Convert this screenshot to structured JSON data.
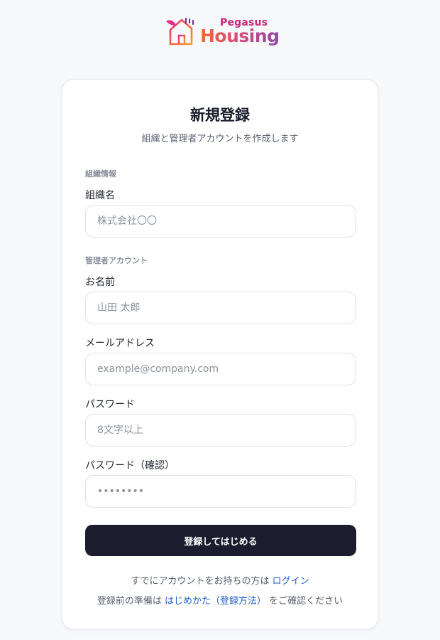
{
  "brand": {
    "top": "Pegasus",
    "name": "Housing",
    "colors": {
      "top": "#c8287a",
      "gradient_start": "#ef6b3a",
      "gradient_end": "#8a4aa8"
    }
  },
  "form": {
    "title": "新規登録",
    "subtitle": "組織と管理者アカウントを作成します",
    "sections": {
      "org": "組織情報",
      "admin": "管理者アカウント"
    },
    "fields": {
      "org_name": {
        "label": "組織名",
        "placeholder": "株式会社〇〇"
      },
      "name": {
        "label": "お名前",
        "placeholder": "山田 太郎"
      },
      "email": {
        "label": "メールアドレス",
        "placeholder": "example@company.com"
      },
      "password": {
        "label": "パスワード",
        "placeholder": "8文字以上"
      },
      "password_confirm": {
        "label": "パスワード（確認）",
        "placeholder": "••••••••"
      }
    },
    "submit_label": "登録してはじめる",
    "footer": {
      "login_prompt": "すでにアカウントをお持ちの方は",
      "login_link": "ログイン",
      "guide_prompt": "登録前の準備は",
      "guide_link": "はじめかた（登録方法）",
      "guide_suffix": "をご確認ください"
    }
  },
  "colors": {
    "background": "#f7f8fa",
    "button": "#1b1c2d",
    "link": "#1f5fcc"
  }
}
